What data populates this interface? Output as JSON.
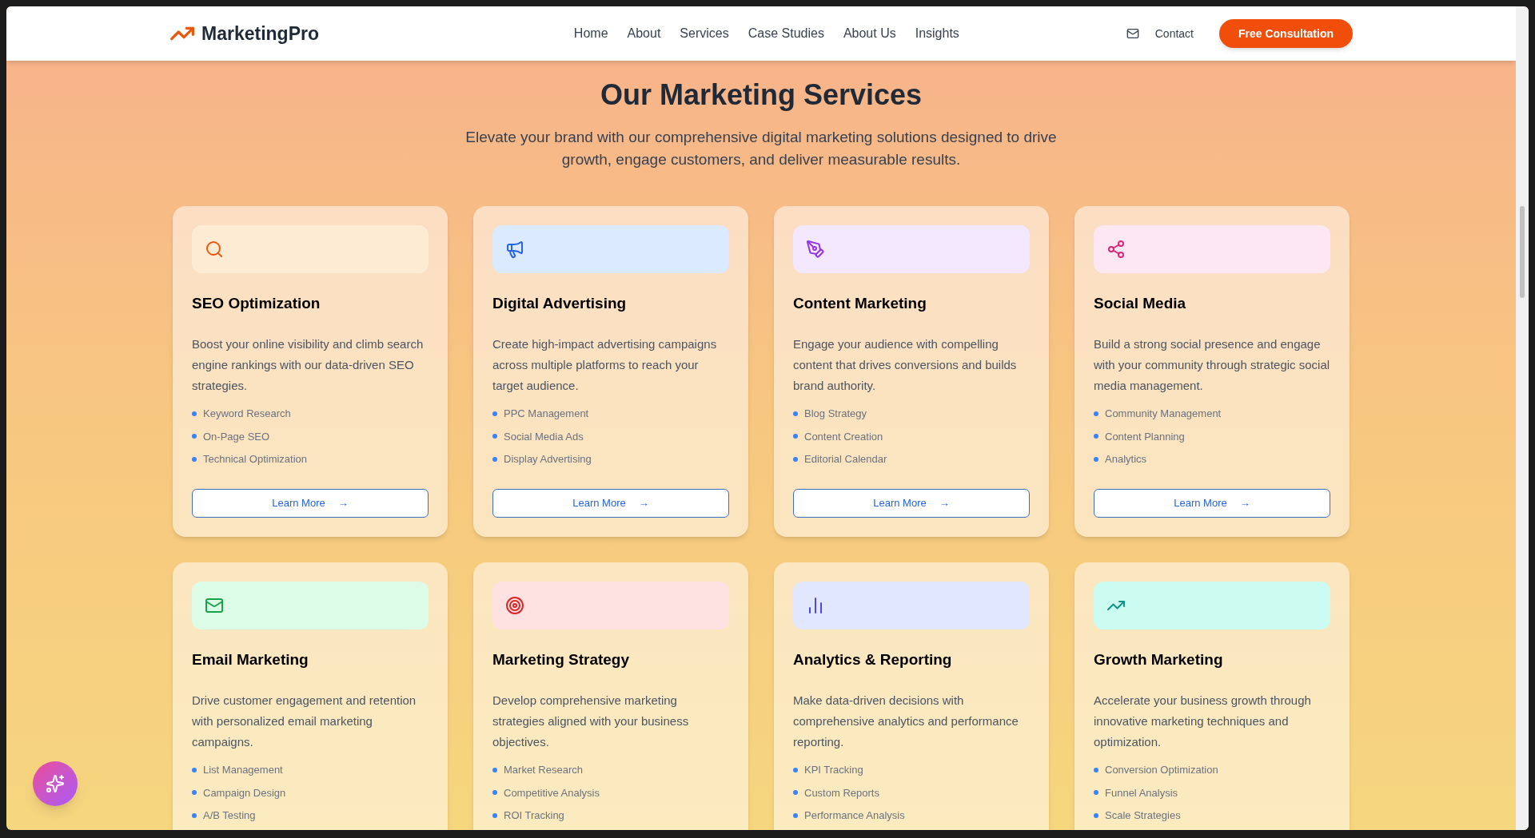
{
  "header": {
    "logo": "MarketingPro",
    "nav": [
      {
        "label": "Home"
      },
      {
        "label": "About"
      },
      {
        "label": "Services"
      },
      {
        "label": "Case Studies"
      },
      {
        "label": "About Us"
      },
      {
        "label": "Insights"
      }
    ],
    "contact": "Contact",
    "cta": "Free Consultation"
  },
  "hero": {
    "title": "Our Marketing Services",
    "subtitle": "Elevate your brand with our comprehensive digital marketing solutions designed to drive growth, engage customers, and deliver measurable results."
  },
  "services": [
    {
      "title": "SEO Optimization",
      "description": "Boost your online visibility and climb search engine rankings with our data-driven SEO strategies.",
      "features": [
        "Keyword Research",
        "On-Page SEO",
        "Technical Optimization"
      ],
      "button": "Learn More",
      "arrow": "→"
    },
    {
      "title": "Digital Advertising",
      "description": "Create high-impact advertising campaigns across multiple platforms to reach your target audience.",
      "features": [
        "PPC Management",
        "Social Media Ads",
        "Display Advertising"
      ],
      "button": "Learn More",
      "arrow": "→"
    },
    {
      "title": "Content Marketing",
      "description": "Engage your audience with compelling content that drives conversions and builds brand authority.",
      "features": [
        "Blog Strategy",
        "Content Creation",
        "Editorial Calendar"
      ],
      "button": "Learn More",
      "arrow": "→"
    },
    {
      "title": "Social Media",
      "description": "Build a strong social presence and engage with your community through strategic social media management.",
      "features": [
        "Community Management",
        "Content Planning",
        "Analytics"
      ],
      "button": "Learn More",
      "arrow": "→"
    },
    {
      "title": "Email Marketing",
      "description": "Drive customer engagement and retention with personalized email marketing campaigns.",
      "features": [
        "List Management",
        "Campaign Design",
        "A/B Testing"
      ]
    },
    {
      "title": "Marketing Strategy",
      "description": "Develop comprehensive marketing strategies aligned with your business objectives.",
      "features": [
        "Market Research",
        "Competitive Analysis",
        "ROI Tracking"
      ]
    },
    {
      "title": "Analytics & Reporting",
      "description": "Make data-driven decisions with comprehensive analytics and performance reporting.",
      "features": [
        "KPI Tracking",
        "Custom Reports",
        "Performance Analysis"
      ]
    },
    {
      "title": "Growth Marketing",
      "description": "Accelerate your business growth through innovative marketing techniques and optimization.",
      "features": [
        "Conversion Optimization",
        "Funnel Analysis",
        "Scale Strategies"
      ]
    }
  ]
}
